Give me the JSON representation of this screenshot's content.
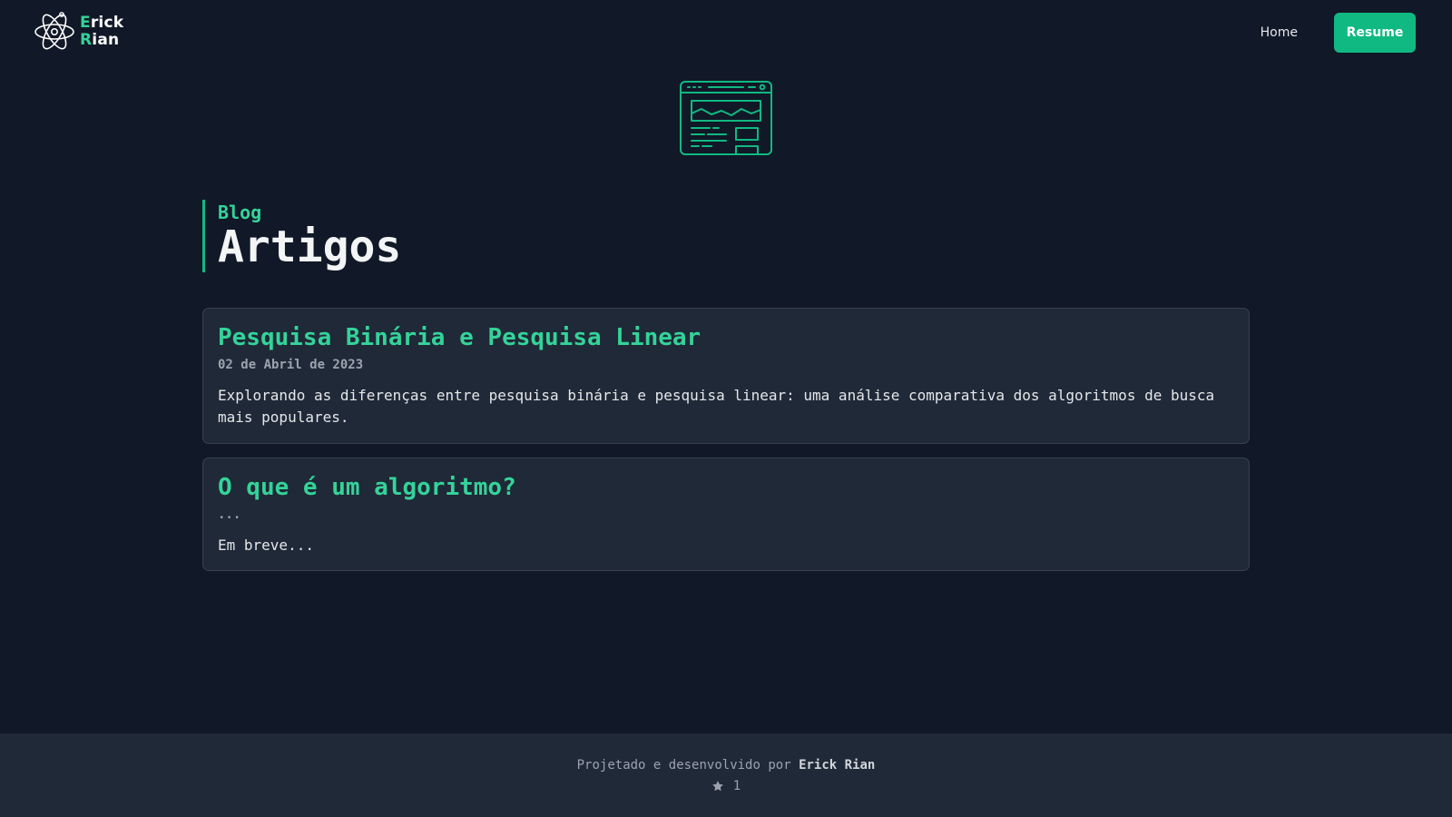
{
  "header": {
    "logo": {
      "line1": "Erick",
      "line2": "Rian",
      "accent_color": "#34d399",
      "icon": "atom-icon"
    },
    "nav": {
      "home_label": "Home",
      "resume_label": "Resume"
    }
  },
  "hero": {
    "icon": "browser-window-icon"
  },
  "section": {
    "kicker": "Blog",
    "title": "Artigos"
  },
  "articles": [
    {
      "title": "Pesquisa Binária e Pesquisa Linear",
      "date": "02 de Abril de 2023",
      "description": "Explorando as diferenças entre pesquisa binária e pesquisa linear: uma análise comparativa dos algoritmos de busca mais populares."
    },
    {
      "title": "O que é um algoritmo?",
      "date": "...",
      "description": "Em breve..."
    }
  ],
  "footer": {
    "credit_prefix": "Projetado e desenvolvido por",
    "credit_author": "Erick Rian",
    "stars": "1",
    "star_icon": "star-icon"
  },
  "colors": {
    "background": "#111827",
    "card": "#1f2937",
    "accent": "#10b981",
    "accent_light": "#34d399"
  }
}
